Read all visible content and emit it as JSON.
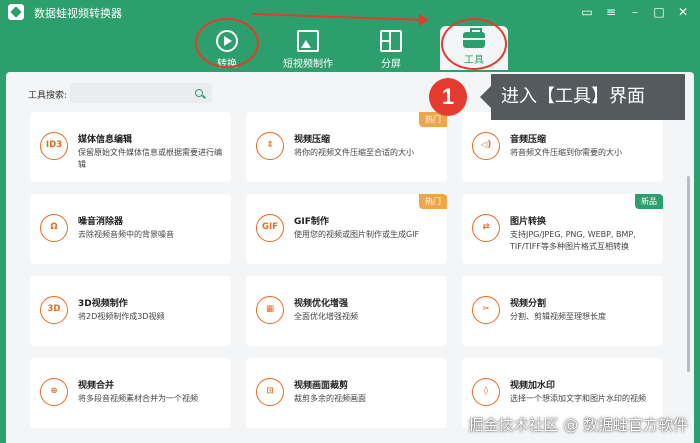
{
  "app": {
    "title": "数据蛙视频转换器"
  },
  "tabs": [
    {
      "label": "转换",
      "icon": "convert-icon"
    },
    {
      "label": "短视频制作",
      "icon": "short-video-icon"
    },
    {
      "label": "分屏",
      "icon": "split-screen-icon"
    },
    {
      "label": "工具",
      "icon": "toolbox-icon",
      "active": true
    }
  ],
  "search": {
    "label": "工具搜索:",
    "value": "",
    "placeholder": ""
  },
  "tools": [
    {
      "title": "媒体信息编辑",
      "desc": "保留原始文件媒体信息或根据需要进行编辑",
      "icon_text": "ID3",
      "badge": ""
    },
    {
      "title": "视频压缩",
      "desc": "将你的视频文件压缩至合适的大小",
      "icon_text": "⇕",
      "badge": "热门"
    },
    {
      "title": "音频压缩",
      "desc": "将音频文件压缩到你需要的大小",
      "icon_text": "◁)",
      "badge": ""
    },
    {
      "title": "噪音消除器",
      "desc": "去除视频音频中的背景噪音",
      "icon_text": "Ω",
      "badge": ""
    },
    {
      "title": "GIF制作",
      "desc": "使用您的视频或图片制作或生成GIF",
      "icon_text": "GIF",
      "badge": "热门"
    },
    {
      "title": "图片转换",
      "desc": "支持JPG/JPEG, PNG, WEBP, BMP, TIF/TIFF等多种图片格式互相转换",
      "icon_text": "⇄",
      "badge": "新品"
    },
    {
      "title": "3D视频制作",
      "desc": "将2D视频制作成3D视频",
      "icon_text": "3D",
      "badge": ""
    },
    {
      "title": "视频优化增强",
      "desc": "全面优化增强视频",
      "icon_text": "▦",
      "badge": ""
    },
    {
      "title": "视频分割",
      "desc": "分割、剪辑视频至理想长度",
      "icon_text": "✂",
      "badge": ""
    },
    {
      "title": "视频合并",
      "desc": "将多段音视频素材合并为一个视频",
      "icon_text": "⊕",
      "badge": ""
    },
    {
      "title": "视频画面裁剪",
      "desc": "裁剪多余的视频画面",
      "icon_text": "⊡",
      "badge": ""
    },
    {
      "title": "视频加水印",
      "desc": "选择一个想添加文字和图片水印的视频",
      "icon_text": "◊",
      "badge": ""
    }
  ],
  "callout": {
    "number": "1",
    "text": "进入【工具】界面"
  },
  "watermark": "掘金技术社区 @ 数据蛙官方软件",
  "colors": {
    "brand": "#2d9f6c",
    "accent": "#e86a1f",
    "annotation": "#e43b2e",
    "hot_badge": "#f0a54a"
  }
}
